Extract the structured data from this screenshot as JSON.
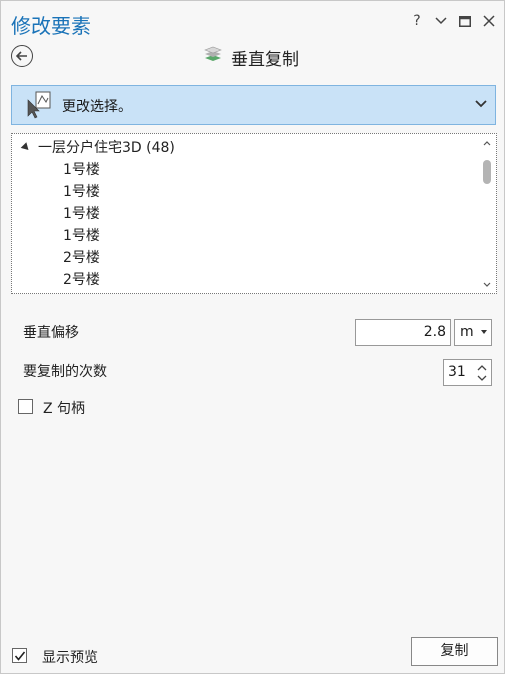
{
  "pane": {
    "title": "修改要素",
    "controls": [
      "help",
      "options-menu",
      "maximize",
      "close"
    ]
  },
  "tool": {
    "title": "垂直复制",
    "back_icon": "back-arrow-icon"
  },
  "selection": {
    "label": "更改选择。"
  },
  "tree": {
    "layer": "一层分户住宅3D (48)",
    "items": [
      "1号楼",
      "1号楼",
      "1号楼",
      "1号楼",
      "2号楼",
      "2号楼"
    ]
  },
  "form": {
    "vertical_offset_label": "垂直偏移",
    "vertical_offset_value": "2.8",
    "unit": "m",
    "copies_label": "要复制的次数",
    "copies_value": "31",
    "z_handle_label": "Z 句柄",
    "z_handle_checked": false
  },
  "footer": {
    "preview_label": "显示预览",
    "preview_checked": true,
    "copy_button": "复制"
  },
  "colors": {
    "title": "#1a73b8",
    "selection_bg": "#c9e2f7",
    "selection_border": "#7fb4e0"
  }
}
